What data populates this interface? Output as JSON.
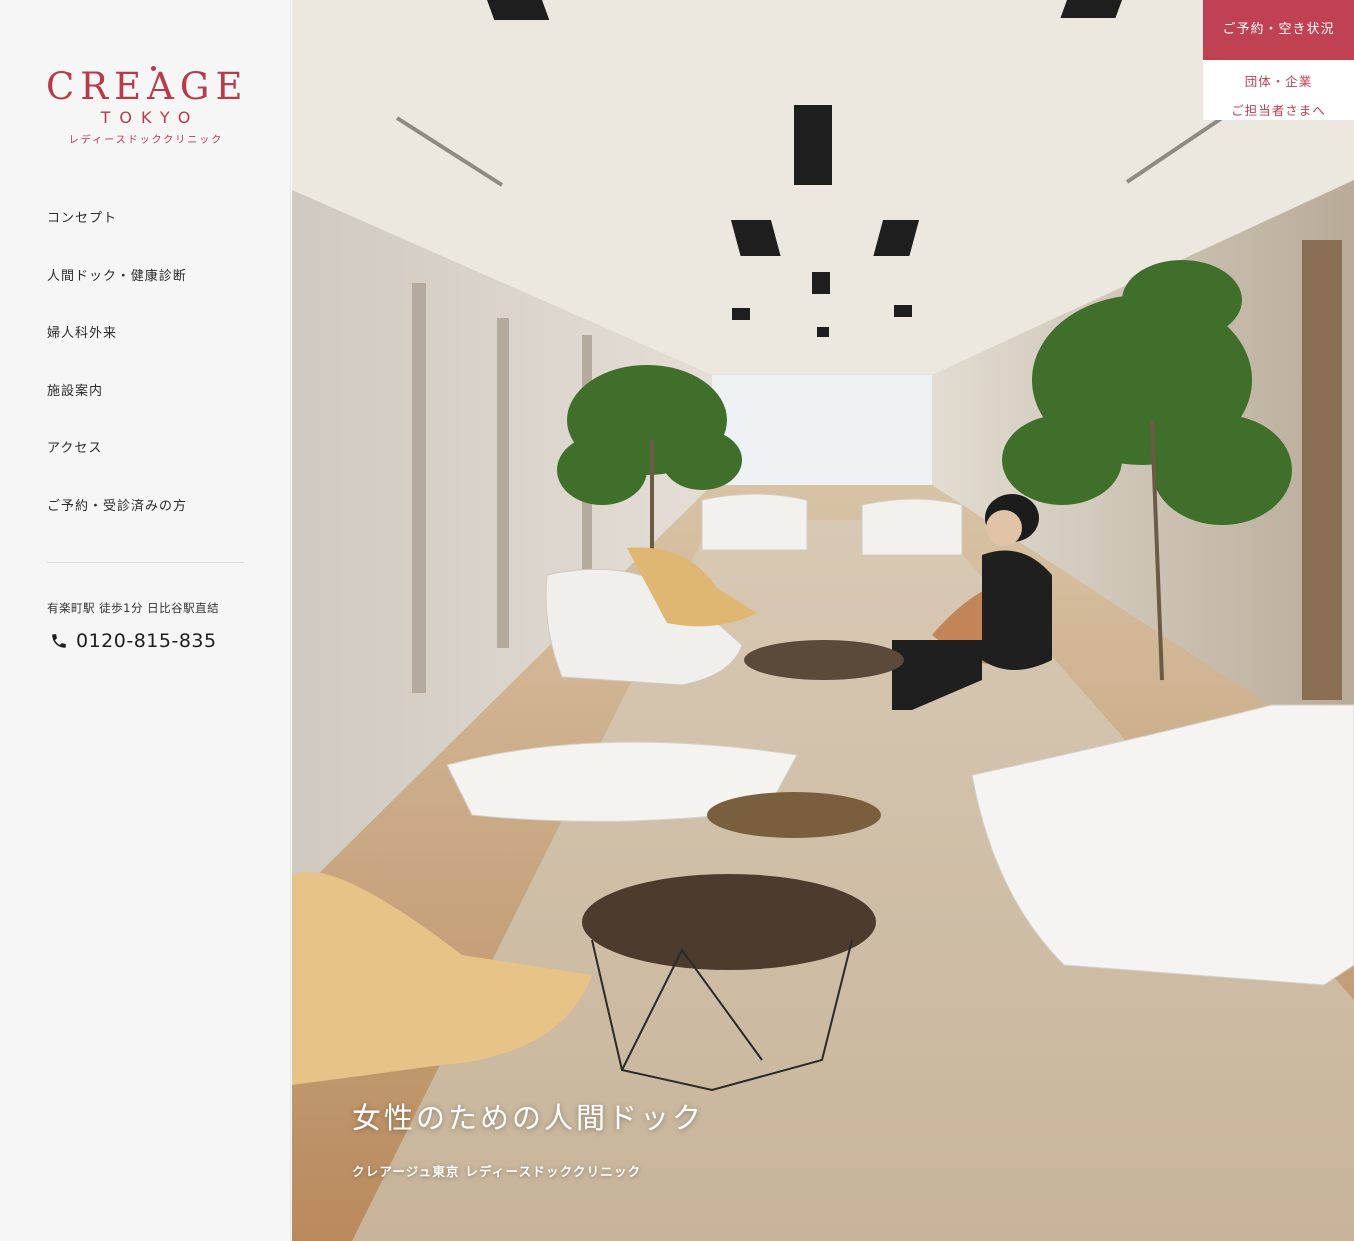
{
  "brand": {
    "logo_main": "CREAGE",
    "logo_sub": "TOKYO",
    "logo_jp": "レディースドッククリニック",
    "accent_color": "#bf4152"
  },
  "nav": {
    "items": [
      {
        "label": "コンセプト"
      },
      {
        "label": "人間ドック・健康診断"
      },
      {
        "label": "婦人科外来"
      },
      {
        "label": "施設案内"
      },
      {
        "label": "アクセス"
      },
      {
        "label": "ご予約・受診済みの方"
      }
    ]
  },
  "contact": {
    "access": "有楽町駅 徒歩1分 日比谷駅直結",
    "phone_icon": "phone-icon",
    "phone": "0120-815-835"
  },
  "header": {
    "reserve_label": "ご予約・空き状況",
    "corporate_line1": "団体・企業",
    "corporate_line2": "ご担当者さまへ"
  },
  "hero": {
    "image_subject": "clinic lounge interior",
    "title": "女性のための人間ドック",
    "subtitle": "クレアージュ東京 レディースドッククリニック"
  }
}
